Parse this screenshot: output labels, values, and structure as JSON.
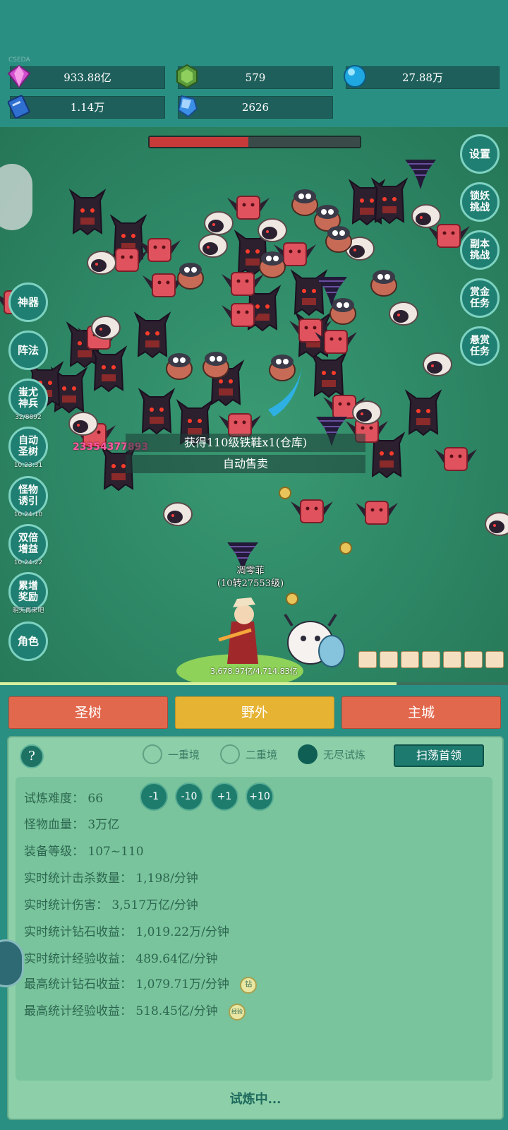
{
  "header": {
    "tag": "CSEDA",
    "resources": [
      {
        "icon": "purple-gem-icon",
        "value": "933.88亿"
      },
      {
        "icon": "green-gem-icon",
        "value": "579"
      },
      {
        "icon": "blue-orb-icon",
        "value": "27.88万"
      },
      {
        "icon": "blue-book-icon",
        "value": "1.14万"
      },
      {
        "icon": "blue-crystal-icon",
        "value": "2626"
      }
    ]
  },
  "battle": {
    "boss_hp_fraction": 0.47,
    "right_buttons": [
      "设置",
      "锁妖挑战",
      "副本挑战",
      "赏金任务",
      "悬赏任务"
    ],
    "left_buttons": [
      {
        "label": "神器",
        "timer": ""
      },
      {
        "label": "阵法",
        "timer": ""
      },
      {
        "label": "蚩尤神兵",
        "timer": "32/8892"
      },
      {
        "label": "自动圣树",
        "timer": "10:23:31"
      },
      {
        "label": "怪物诱引",
        "timer": "10:24:10"
      },
      {
        "label": "双倍增益",
        "timer": "10:24:22"
      },
      {
        "label": "累增奖励",
        "timer": "明天再来吧"
      },
      {
        "label": "角色",
        "timer": ""
      }
    ],
    "damage_number": "23354377893",
    "loot_message": "获得110级铁鞋x1(仓库)",
    "auto_sell": "自动售卖",
    "hero_name": "凋零菲",
    "hero_level": "(10转27553级)",
    "exp_text": "3,678.97亿/4,714.83亿",
    "exp_fraction": 0.78
  },
  "tabs": {
    "left": "圣树",
    "middle": "野外",
    "right": "主城"
  },
  "panel": {
    "help": "?",
    "modes": [
      {
        "label": "一重境",
        "selected": false
      },
      {
        "label": "二重境",
        "selected": false
      },
      {
        "label": "无尽试炼",
        "selected": true
      }
    ],
    "sweep_button": "扫荡首领",
    "difficulty_label": "试炼难度：",
    "difficulty_value": "66",
    "adjust_buttons": [
      "-1",
      "-10",
      "+1",
      "+10"
    ],
    "stats": [
      "怪物血量：  3万亿",
      "装备等级：  107~110",
      "实时统计击杀数量：  1,198/分钟",
      "实时统计伤害：  3,517万亿/分钟",
      "实时统计钻石收益：  1,019.22万/分钟",
      "实时统计经验收益：  489.64亿/分钟",
      "最高统计钻石收益：  1,079.71万/分钟",
      "最高统计经验收益：  518.45亿/分钟"
    ],
    "badge_diamond": "钻",
    "badge_exp": "经验",
    "status": "试炼中..."
  }
}
